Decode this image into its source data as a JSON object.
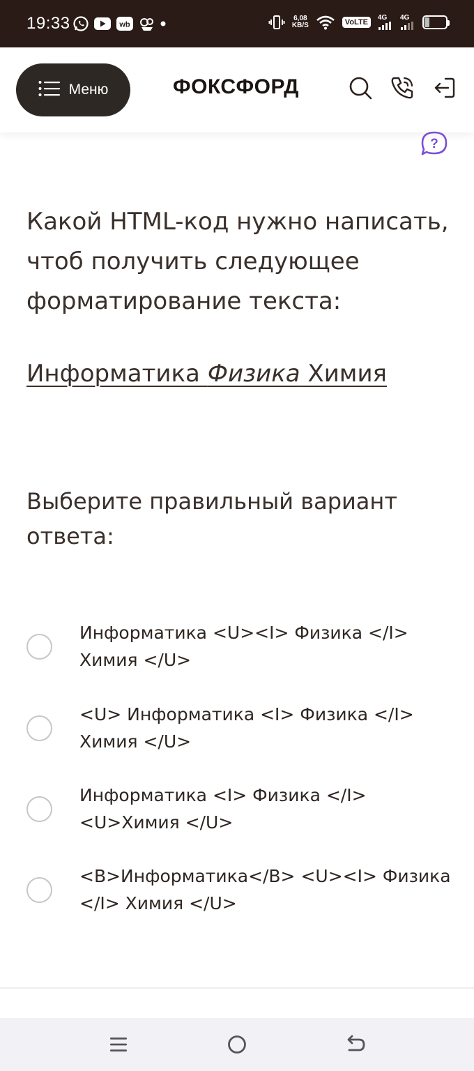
{
  "status_bar": {
    "time": "19:33",
    "network_speed_value": "6,08",
    "network_speed_unit": "KB/S",
    "volte": "VoLTE",
    "sim1_type": "4G",
    "sim2_type": "4G",
    "battery_level": "22",
    "battery_fraction": 0.22,
    "icons_left": [
      "whatsapp-icon",
      "youtube-icon",
      "wildberries-icon",
      "app-icon",
      "dot-icon"
    ],
    "icons_right": [
      "vibrate-icon",
      "wifi-icon",
      "signal-icon",
      "signal-icon",
      "battery-icon"
    ]
  },
  "header": {
    "menu_label": "Меню",
    "logo": "ФОКСФОРД",
    "icons": [
      "search-icon",
      "phone-icon",
      "login-icon"
    ]
  },
  "question": {
    "text": "Какой HTML-код нужно написать, чтоб получить следующее форматирование текста:",
    "example_part1": "Информатика ",
    "example_part2": "Физика",
    "example_part3": " Химия",
    "instruction": "Выберите правильный вариант ответа:"
  },
  "options": [
    "Информатика <U><I> Физика </I>\nХимия </U>",
    "<U> Информатика <I> Физика </I>\nХимия </U>",
    "Информатика <I> Физика </I>\n<U>Химия </U>",
    "<B>Информатика</B> <U><I> Физика\n</I> Химия </U>"
  ],
  "colors": {
    "status_bar_bg": "#2b1b17",
    "menu_button_bg": "#2e2824",
    "help_icon": "#7b4fd6",
    "text": "#3a302b",
    "nav_bar_bg": "#f2f1f6"
  },
  "nav_bar": {
    "icons": [
      "recent-apps-icon",
      "home-icon",
      "back-icon"
    ]
  }
}
